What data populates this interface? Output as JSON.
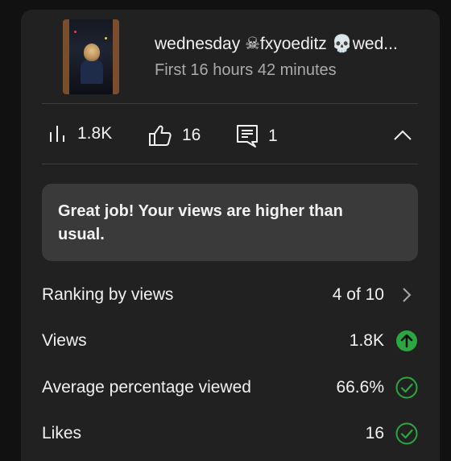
{
  "video": {
    "title": "wednesday ☠fxyoeditz 💀wed...",
    "subtitle": "First 16 hours 42 minutes",
    "thumbnail_icon": "video-thumbnail"
  },
  "stats": {
    "views": "1.8K",
    "likes": "16",
    "comments": "1"
  },
  "callout": {
    "text": "Great job! Your views are higher than usual."
  },
  "metrics": [
    {
      "label": "Ranking by views",
      "value": "4 of 10",
      "icon": "chevron-right-icon"
    },
    {
      "label": "Views",
      "value": "1.8K",
      "icon": "arrow-up-circle-icon"
    },
    {
      "label": "Average percentage viewed",
      "value": "66.6%",
      "icon": "check-circle-icon"
    },
    {
      "label": "Likes",
      "value": "16",
      "icon": "check-circle-icon"
    }
  ],
  "colors": {
    "background": "#111111",
    "card": "#212121",
    "callout": "#3a3a3a",
    "success_green": "#2ba640",
    "secondary_text": "#aaaaaa"
  }
}
